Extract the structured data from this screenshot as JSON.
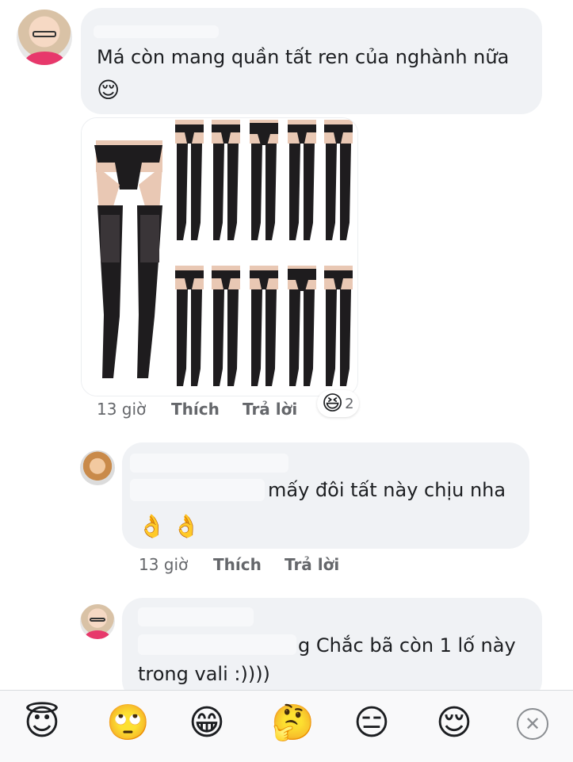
{
  "comment1": {
    "text_line1": "Má còn mang quần tất ren của nghành nữa",
    "emoji": "😌",
    "time": "13 giờ",
    "like_label": "Thích",
    "reply_label": "Trả lời",
    "reaction_emoji": "😆",
    "reaction_count": "2"
  },
  "comment2": {
    "text_line1": "mấy đôi tất này chịu nha",
    "emoji_line": "👌 👌",
    "time": "13 giờ",
    "like_label": "Thích",
    "reply_label": "Trả lời"
  },
  "comment3": {
    "text_line1": "g Chắc bã còn 1 lố này",
    "text_line2": "trong vali :))))"
  },
  "emoji_tray": {
    "items": [
      "😇",
      "🙄",
      "😁",
      "🤔",
      "😑",
      "😌"
    ],
    "close_glyph": "✕"
  },
  "colors": {
    "bubble": "#f0f2f5",
    "meta_text": "#65676b"
  }
}
